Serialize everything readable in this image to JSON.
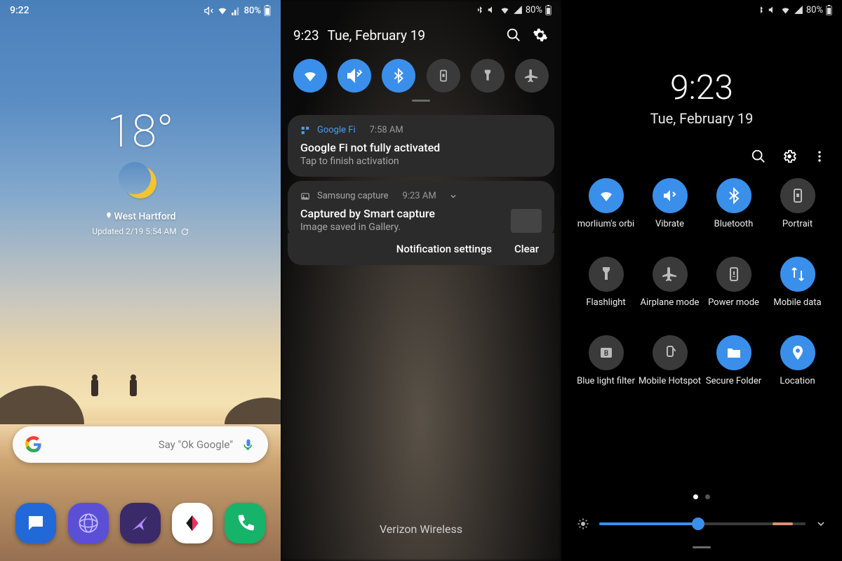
{
  "home": {
    "status": {
      "time": "9:22",
      "battery": "80%"
    },
    "weather": {
      "temp": "18°",
      "location": "West Hartford",
      "updated": "Updated 2/19 5:54 AM"
    },
    "search_hint": "Say \"Ok Google\"",
    "dock": [
      "messages",
      "browser",
      "email",
      "music",
      "phone"
    ]
  },
  "shade": {
    "status_battery": "80%",
    "time": "9:23",
    "date": "Tue, February 19",
    "quick_toggles": [
      {
        "name": "wifi",
        "on": true
      },
      {
        "name": "vibrate",
        "on": true
      },
      {
        "name": "bluetooth",
        "on": true
      },
      {
        "name": "rotation-lock",
        "on": false
      },
      {
        "name": "flashlight",
        "on": false
      },
      {
        "name": "airplane",
        "on": false
      }
    ],
    "notifications": [
      {
        "app": "Google Fi",
        "time": "7:58 AM",
        "title": "Google Fi not fully activated",
        "body": "Tap to finish activation"
      },
      {
        "app": "Samsung capture",
        "time": "9:23 AM",
        "title": "Captured by Smart capture",
        "body": "Image saved in Gallery."
      }
    ],
    "action_settings": "Notification settings",
    "action_clear": "Clear",
    "carrier": "Verizon Wireless"
  },
  "qs": {
    "status_battery": "80%",
    "time": "9:23",
    "date": "Tue, February 19",
    "tiles": [
      {
        "name": "wifi",
        "label": "morlium's orbi",
        "on": true
      },
      {
        "name": "vibrate",
        "label": "Vibrate",
        "on": true
      },
      {
        "name": "bluetooth",
        "label": "Bluetooth",
        "on": true
      },
      {
        "name": "portrait",
        "label": "Portrait",
        "on": false
      },
      {
        "name": "flashlight",
        "label": "Flashlight",
        "on": false
      },
      {
        "name": "airplane",
        "label": "Airplane mode",
        "on": false
      },
      {
        "name": "power",
        "label": "Power mode",
        "on": false
      },
      {
        "name": "mobile-data",
        "label": "Mobile data",
        "on": true
      },
      {
        "name": "blue-light",
        "label": "Blue light filter",
        "on": false
      },
      {
        "name": "hotspot",
        "label": "Mobile Hotspot",
        "on": false
      },
      {
        "name": "secure-folder",
        "label": "Secure Folder",
        "on": true
      },
      {
        "name": "location",
        "label": "Location",
        "on": true
      }
    ],
    "brightness_percent": 48
  },
  "colors": {
    "accent": "#3a8fea"
  }
}
